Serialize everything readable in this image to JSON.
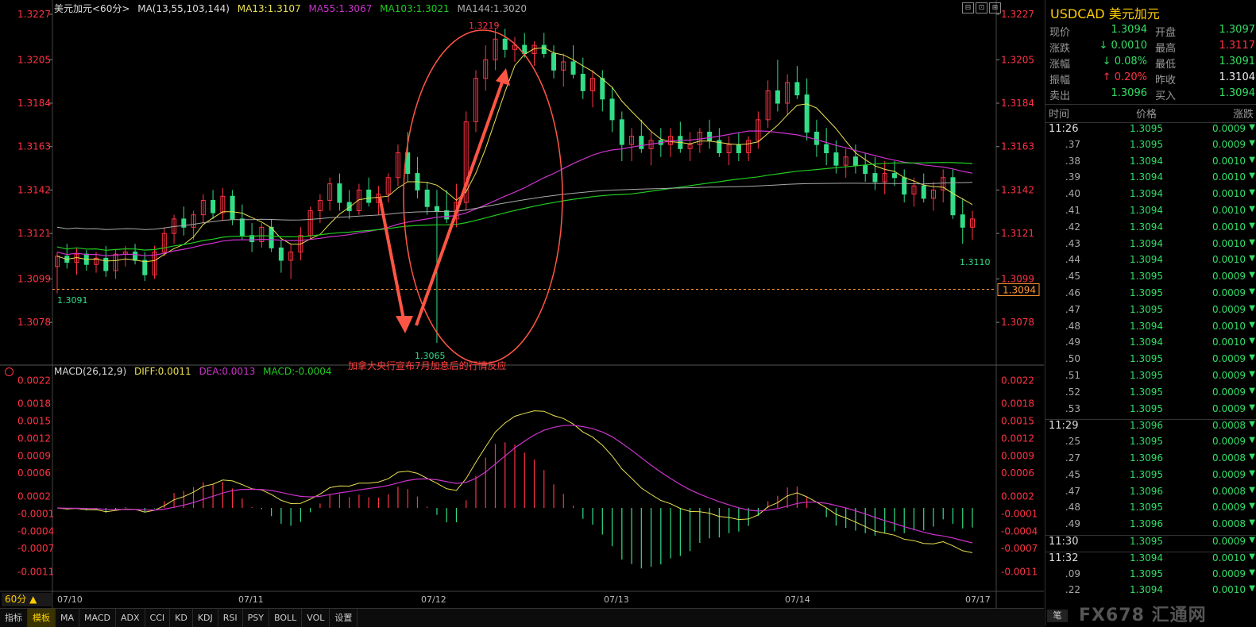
{
  "symbol_title": "美元加元<60分>",
  "ma_header": {
    "label": "MA(13,55,103,144)",
    "ma13": "MA13:1.3107",
    "ma55": "MA55:1.3067",
    "ma103": "MA103:1.3021",
    "ma144": "MA144:1.3020"
  },
  "macd_header": {
    "label": "MACD(26,12,9)",
    "diff": "DIFF:0.0011",
    "dea": "DEA:0.0013",
    "macd": "MACD:-0.0004"
  },
  "price_axis_left": [
    "1.3227",
    "1.3205",
    "1.3184",
    "1.3163",
    "1.3142",
    "1.3121",
    "1.3099",
    "1.3078"
  ],
  "price_axis_right": [
    "1.3227",
    "1.3205",
    "1.3184",
    "1.3163",
    "1.3142",
    "1.3121",
    "1.3099",
    "1.3078"
  ],
  "macd_axis_left": [
    "0.0022",
    "0.0018",
    "0.0015",
    "0.0012",
    "0.0009",
    "0.0006",
    "0.0002",
    "-0.0001",
    "-0.0004",
    "-0.0007",
    "-0.0011"
  ],
  "macd_axis_right": [
    "0.0022",
    "0.0018",
    "0.0015",
    "0.0012",
    "0.0009",
    "0.0006",
    "0.0002",
    "-0.0001",
    "-0.0004",
    "-0.0007",
    "-0.0011"
  ],
  "current_price_tag": "1.3094",
  "labels": {
    "high": "1.3219",
    "low": "1.3065",
    "recent_low": "1.3110",
    "start_low": "1.3091"
  },
  "annotation": "加拿大央行宣布7月加息后的行情反应",
  "x_dates": [
    "07/10",
    "07/11",
    "07/12",
    "07/13",
    "07/14",
    "07/17"
  ],
  "period_button": "60分 ▲",
  "bottom_tabs": [
    "指标",
    "模板",
    "MA",
    "MACD",
    "ADX",
    "CCI",
    "KD",
    "KDJ",
    "RSI",
    "PSY",
    "BOLL",
    "VOL",
    "设置"
  ],
  "window_buttons": [
    "⊟",
    "⊡",
    "⊞"
  ],
  "colors": {
    "up": "#ff3344",
    "down": "#33dd88",
    "ma13": "#e8e050",
    "ma55": "#cc33cc",
    "ma103": "#22cc22",
    "ma144": "#aaaaaa",
    "annotation": "#ff5544"
  },
  "panel": {
    "title": "USDCAD 美元加元",
    "quote": [
      {
        "l1": "现价",
        "v1": "1.3094",
        "l2": "开盘",
        "v2": "1.3097",
        "c1": "green",
        "c2": "green"
      },
      {
        "l1": "涨跌",
        "v1": "↓ 0.0010",
        "l2": "最高",
        "v2": "1.3117",
        "c1": "green",
        "c2": "red"
      },
      {
        "l1": "涨幅",
        "v1": "↓ 0.08%",
        "l2": "最低",
        "v2": "1.3091",
        "c1": "green",
        "c2": "green"
      },
      {
        "l1": "振幅",
        "v1": "↑ 0.20%",
        "l2": "昨收",
        "v2": "1.3104",
        "c1": "red",
        "c2": "white"
      },
      {
        "l1": "卖出",
        "v1": "1.3096",
        "l2": "买入",
        "v2": "1.3094",
        "c1": "green",
        "c2": "green"
      }
    ],
    "table_headers": [
      "时间",
      "价格",
      "涨跌"
    ],
    "ticks": [
      {
        "t": "11:26",
        "p": "1.3095",
        "c": "0.0009",
        "full": true
      },
      {
        "t": ".37",
        "p": "1.3095",
        "c": "0.0009"
      },
      {
        "t": ".38",
        "p": "1.3094",
        "c": "0.0010"
      },
      {
        "t": ".39",
        "p": "1.3094",
        "c": "0.0010"
      },
      {
        "t": ".40",
        "p": "1.3094",
        "c": "0.0010"
      },
      {
        "t": ".41",
        "p": "1.3094",
        "c": "0.0010"
      },
      {
        "t": ".42",
        "p": "1.3094",
        "c": "0.0010"
      },
      {
        "t": ".43",
        "p": "1.3094",
        "c": "0.0010"
      },
      {
        "t": ".44",
        "p": "1.3094",
        "c": "0.0010"
      },
      {
        "t": ".45",
        "p": "1.3095",
        "c": "0.0009"
      },
      {
        "t": ".46",
        "p": "1.3095",
        "c": "0.0009"
      },
      {
        "t": ".47",
        "p": "1.3095",
        "c": "0.0009"
      },
      {
        "t": ".48",
        "p": "1.3094",
        "c": "0.0010"
      },
      {
        "t": ".49",
        "p": "1.3094",
        "c": "0.0010"
      },
      {
        "t": ".50",
        "p": "1.3095",
        "c": "0.0009"
      },
      {
        "t": ".51",
        "p": "1.3095",
        "c": "0.0009"
      },
      {
        "t": ".52",
        "p": "1.3095",
        "c": "0.0009"
      },
      {
        "t": ".53",
        "p": "1.3095",
        "c": "0.0009"
      },
      {
        "t": "11:29",
        "p": "1.3096",
        "c": "0.0008",
        "full": true
      },
      {
        "t": ".25",
        "p": "1.3095",
        "c": "0.0009"
      },
      {
        "t": ".27",
        "p": "1.3096",
        "c": "0.0008"
      },
      {
        "t": ".45",
        "p": "1.3095",
        "c": "0.0009"
      },
      {
        "t": ".47",
        "p": "1.3096",
        "c": "0.0008"
      },
      {
        "t": ".48",
        "p": "1.3095",
        "c": "0.0009"
      },
      {
        "t": ".49",
        "p": "1.3096",
        "c": "0.0008"
      },
      {
        "t": "11:30",
        "p": "1.3095",
        "c": "0.0009",
        "full": true
      },
      {
        "t": "11:32",
        "p": "1.3094",
        "c": "0.0010",
        "full": true
      },
      {
        "t": ".09",
        "p": "1.3095",
        "c": "0.0009"
      },
      {
        "t": ".22",
        "p": "1.3094",
        "c": "0.0010"
      }
    ],
    "foot_button": "笔"
  },
  "watermark": "FX678 汇通网",
  "chart_data": {
    "type": "candlestick",
    "price_ylim": [
      1.3065,
      1.3227
    ],
    "candles": [
      [
        1.3105,
        1.3112,
        1.3092,
        1.311
      ],
      [
        1.311,
        1.3116,
        1.3104,
        1.3107
      ],
      [
        1.3107,
        1.3114,
        1.3101,
        1.3111
      ],
      [
        1.3111,
        1.3113,
        1.3103,
        1.3106
      ],
      [
        1.3106,
        1.3112,
        1.3102,
        1.3109
      ],
      [
        1.3109,
        1.3115,
        1.31,
        1.3103
      ],
      [
        1.3103,
        1.3113,
        1.3099,
        1.3111
      ],
      [
        1.3111,
        1.3115,
        1.3105,
        1.3112
      ],
      [
        1.3112,
        1.3116,
        1.3106,
        1.3108
      ],
      [
        1.3108,
        1.3112,
        1.3098,
        1.3101
      ],
      [
        1.3101,
        1.3115,
        1.3099,
        1.3112
      ],
      [
        1.3112,
        1.3124,
        1.311,
        1.3121
      ],
      [
        1.3121,
        1.313,
        1.3116,
        1.3128
      ],
      [
        1.3128,
        1.3134,
        1.312,
        1.3124
      ],
      [
        1.3124,
        1.3132,
        1.3118,
        1.313
      ],
      [
        1.313,
        1.314,
        1.3126,
        1.3137
      ],
      [
        1.3137,
        1.3142,
        1.3128,
        1.3131
      ],
      [
        1.3131,
        1.3143,
        1.3127,
        1.3139
      ],
      [
        1.3139,
        1.3142,
        1.3125,
        1.3128
      ],
      [
        1.3128,
        1.3135,
        1.3118,
        1.312
      ],
      [
        1.312,
        1.3126,
        1.3112,
        1.3117
      ],
      [
        1.3117,
        1.3126,
        1.3114,
        1.3124
      ],
      [
        1.3124,
        1.3128,
        1.3112,
        1.3114
      ],
      [
        1.3114,
        1.3118,
        1.3102,
        1.3108
      ],
      [
        1.3108,
        1.3116,
        1.3099,
        1.3112
      ],
      [
        1.3112,
        1.3124,
        1.3108,
        1.312
      ],
      [
        1.312,
        1.3134,
        1.3118,
        1.3132
      ],
      [
        1.3132,
        1.314,
        1.3126,
        1.3137
      ],
      [
        1.3137,
        1.3148,
        1.3132,
        1.3145
      ],
      [
        1.3145,
        1.315,
        1.3132,
        1.3136
      ],
      [
        1.3136,
        1.3142,
        1.3128,
        1.3132
      ],
      [
        1.3132,
        1.3145,
        1.313,
        1.3142
      ],
      [
        1.3142,
        1.3148,
        1.3134,
        1.3136
      ],
      [
        1.3136,
        1.3144,
        1.313,
        1.314
      ],
      [
        1.314,
        1.315,
        1.3136,
        1.3148
      ],
      [
        1.3148,
        1.3164,
        1.3144,
        1.316
      ],
      [
        1.316,
        1.317,
        1.3146,
        1.315
      ],
      [
        1.315,
        1.3158,
        1.3138,
        1.3142
      ],
      [
        1.3142,
        1.3146,
        1.313,
        1.3134
      ],
      [
        1.3134,
        1.3142,
        1.3068,
        1.3132
      ],
      [
        1.3132,
        1.3142,
        1.3126,
        1.3128
      ],
      [
        1.3128,
        1.3145,
        1.3124,
        1.3136
      ],
      [
        1.3136,
        1.318,
        1.3132,
        1.3175
      ],
      [
        1.3175,
        1.32,
        1.317,
        1.3196
      ],
      [
        1.3196,
        1.3212,
        1.319,
        1.3205
      ],
      [
        1.3205,
        1.322,
        1.32,
        1.3215
      ],
      [
        1.3215,
        1.322,
        1.3206,
        1.321
      ],
      [
        1.321,
        1.3216,
        1.3204,
        1.3212
      ],
      [
        1.3212,
        1.3218,
        1.3206,
        1.3208
      ],
      [
        1.3208,
        1.3214,
        1.3202,
        1.3212
      ],
      [
        1.3212,
        1.3218,
        1.3206,
        1.3208
      ],
      [
        1.3208,
        1.3212,
        1.3196,
        1.32
      ],
      [
        1.32,
        1.3208,
        1.3192,
        1.3204
      ],
      [
        1.3204,
        1.3212,
        1.3196,
        1.3198
      ],
      [
        1.3198,
        1.3206,
        1.3186,
        1.319
      ],
      [
        1.319,
        1.32,
        1.3182,
        1.3196
      ],
      [
        1.3196,
        1.32,
        1.318,
        1.3186
      ],
      [
        1.3186,
        1.3192,
        1.317,
        1.3176
      ],
      [
        1.3176,
        1.318,
        1.3156,
        1.3164
      ],
      [
        1.3164,
        1.3172,
        1.3156,
        1.3168
      ],
      [
        1.3168,
        1.3176,
        1.316,
        1.3162
      ],
      [
        1.3162,
        1.317,
        1.3154,
        1.3166
      ],
      [
        1.3166,
        1.3172,
        1.3158,
        1.3164
      ],
      [
        1.3164,
        1.3172,
        1.3158,
        1.3168
      ],
      [
        1.3168,
        1.3175,
        1.316,
        1.3162
      ],
      [
        1.3162,
        1.317,
        1.3156,
        1.3164
      ],
      [
        1.3164,
        1.3172,
        1.316,
        1.317
      ],
      [
        1.317,
        1.3176,
        1.3162,
        1.3166
      ],
      [
        1.3166,
        1.3172,
        1.3158,
        1.316
      ],
      [
        1.316,
        1.3168,
        1.3154,
        1.3164
      ],
      [
        1.3164,
        1.317,
        1.3156,
        1.316
      ],
      [
        1.316,
        1.3168,
        1.3156,
        1.3166
      ],
      [
        1.3166,
        1.318,
        1.3162,
        1.3176
      ],
      [
        1.3176,
        1.3195,
        1.3172,
        1.319
      ],
      [
        1.319,
        1.3205,
        1.318,
        1.3184
      ],
      [
        1.3184,
        1.3198,
        1.3178,
        1.3194
      ],
      [
        1.3194,
        1.3202,
        1.3186,
        1.3188
      ],
      [
        1.3188,
        1.3196,
        1.3166,
        1.317
      ],
      [
        1.317,
        1.3176,
        1.3158,
        1.3164
      ],
      [
        1.3164,
        1.3172,
        1.3154,
        1.316
      ],
      [
        1.316,
        1.3166,
        1.315,
        1.3154
      ],
      [
        1.3154,
        1.3162,
        1.3148,
        1.3158
      ],
      [
        1.3158,
        1.3164,
        1.315,
        1.3154
      ],
      [
        1.3154,
        1.316,
        1.3146,
        1.315
      ],
      [
        1.315,
        1.3158,
        1.3142,
        1.3146
      ],
      [
        1.3146,
        1.3156,
        1.314,
        1.315
      ],
      [
        1.315,
        1.3156,
        1.3144,
        1.3148
      ],
      [
        1.3148,
        1.3152,
        1.3136,
        1.314
      ],
      [
        1.314,
        1.3148,
        1.3134,
        1.3144
      ],
      [
        1.3144,
        1.315,
        1.3136,
        1.3138
      ],
      [
        1.3138,
        1.3146,
        1.3132,
        1.3142
      ],
      [
        1.3142,
        1.3152,
        1.3136,
        1.3148
      ],
      [
        1.3148,
        1.3152,
        1.3128,
        1.313
      ],
      [
        1.313,
        1.3138,
        1.3116,
        1.3124
      ],
      [
        1.3124,
        1.3132,
        1.3118,
        1.3128
      ]
    ],
    "macd_ylim": [
      -0.0013,
      0.0023
    ]
  }
}
